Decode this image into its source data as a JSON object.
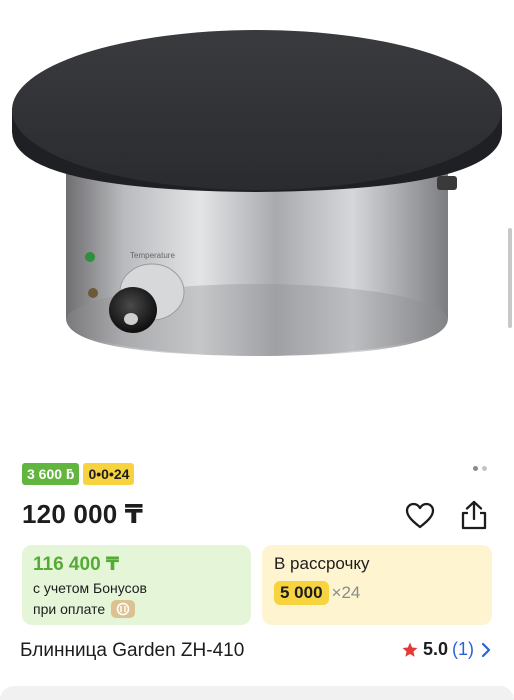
{
  "product": {
    "badges": {
      "bonus": "3 600 ƃ",
      "installment": "0•0•24"
    },
    "price": "120 000 ₸",
    "bonus_card": {
      "price": "116 400 ₸",
      "line1": "с учетом Бонусов",
      "line2": "при оплате"
    },
    "installment_card": {
      "title": "В рассрочку",
      "amount": "5 000",
      "months": "×24"
    },
    "title": "Блинница Garden ZH-410",
    "rating": {
      "value": "5.0",
      "count": "(1)"
    },
    "gallery": {
      "total": 2,
      "active": 1
    }
  },
  "colors": {
    "bonus_green": "#62b53f",
    "installment_yellow": "#f7d33f",
    "star_red": "#e53935",
    "link_blue": "#2d62d3"
  },
  "icons": {
    "favorite": "heart-outline-icon",
    "share": "share-icon",
    "rating_star": "star-icon",
    "chevron": "chevron-right-icon",
    "payment": "kaspi-pay-icon"
  }
}
